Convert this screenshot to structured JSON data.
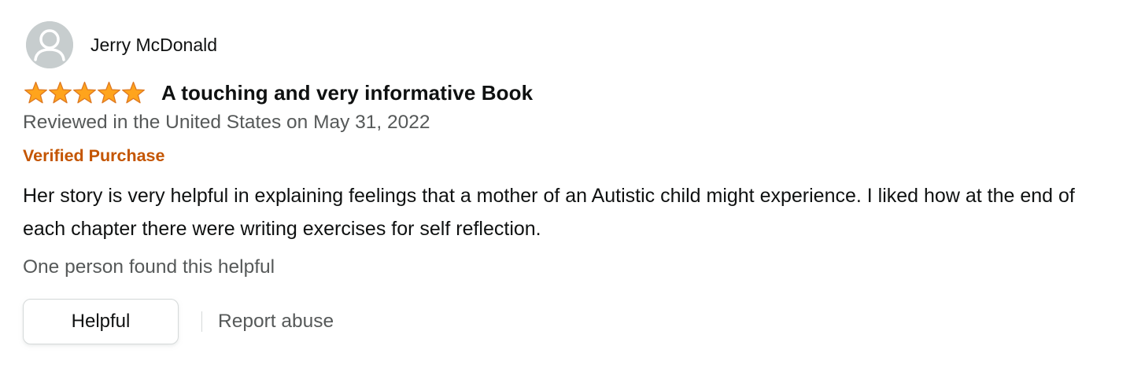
{
  "reviewer": {
    "name": "Jerry McDonald",
    "avatar_icon": "default-user-avatar"
  },
  "rating": {
    "stars": 5,
    "max": 5,
    "star_color": "#ffa41c",
    "star_border": "#de7921"
  },
  "review": {
    "title": "A touching and very informative Book",
    "date_line": "Reviewed in the United States on May 31, 2022",
    "verified_label": "Verified Purchase",
    "body": "Her story is very helpful in explaining feelings that a mother of an Autistic child might experience. I liked how at the end of each chapter there were writing exercises for self reflection.",
    "helpful_count_text": "One person found this helpful"
  },
  "actions": {
    "helpful_label": "Helpful",
    "report_label": "Report abuse"
  },
  "colors": {
    "verified": "#c45500",
    "secondary_text": "#565959",
    "primary_text": "#0f1111"
  }
}
